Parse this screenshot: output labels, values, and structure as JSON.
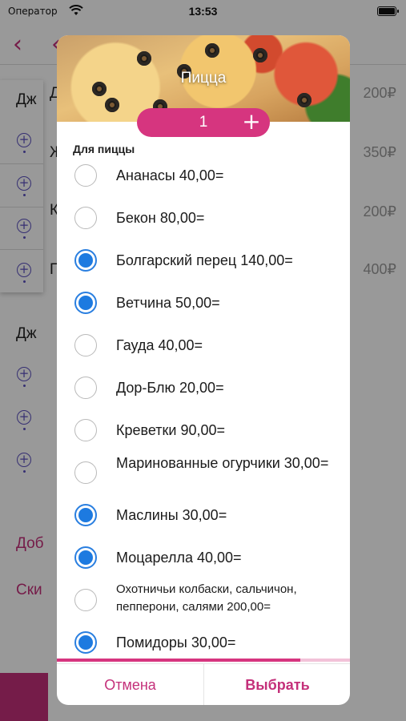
{
  "status_bar": {
    "carrier": "Оператор",
    "time": "13:53"
  },
  "background": {
    "side_title_1": "Дж",
    "side_title_2": "Дж",
    "row_letters": [
      "Д",
      "Ж",
      "К",
      "П"
    ],
    "prices": [
      "200₽",
      "350₽",
      "200₽",
      "400₽"
    ],
    "side_links": [
      "Доб",
      "Ски"
    ]
  },
  "modal": {
    "title": "Пицца",
    "quantity": "1",
    "section_label": "Для пиццы",
    "options": [
      {
        "label": "Ананасы 40,00=",
        "selected": false
      },
      {
        "label": "Бекон 80,00=",
        "selected": false
      },
      {
        "label": "Болгарский перец 140,00=",
        "selected": true
      },
      {
        "label": "Ветчина 50,00=",
        "selected": true
      },
      {
        "label": "Гауда 40,00=",
        "selected": false
      },
      {
        "label": "Дор-Блю 20,00=",
        "selected": false
      },
      {
        "label": "Креветки 90,00=",
        "selected": false
      },
      {
        "label": "Маринованные огурчики 30,00=",
        "selected": false
      },
      {
        "label": "Маслины 30,00=",
        "selected": true
      },
      {
        "label": "Моцарелла 40,00=",
        "selected": true
      },
      {
        "label": "Охотничьи колбаски, сальчичон, пепперони, салями 200,00=",
        "selected": false
      },
      {
        "label": "Помидоры 30,00=",
        "selected": true
      }
    ],
    "scroll_progress": 0.83,
    "cancel_label": "Отмена",
    "select_label": "Выбрать",
    "accent_color": "#d6357f",
    "radio_color": "#1d7ae0"
  }
}
